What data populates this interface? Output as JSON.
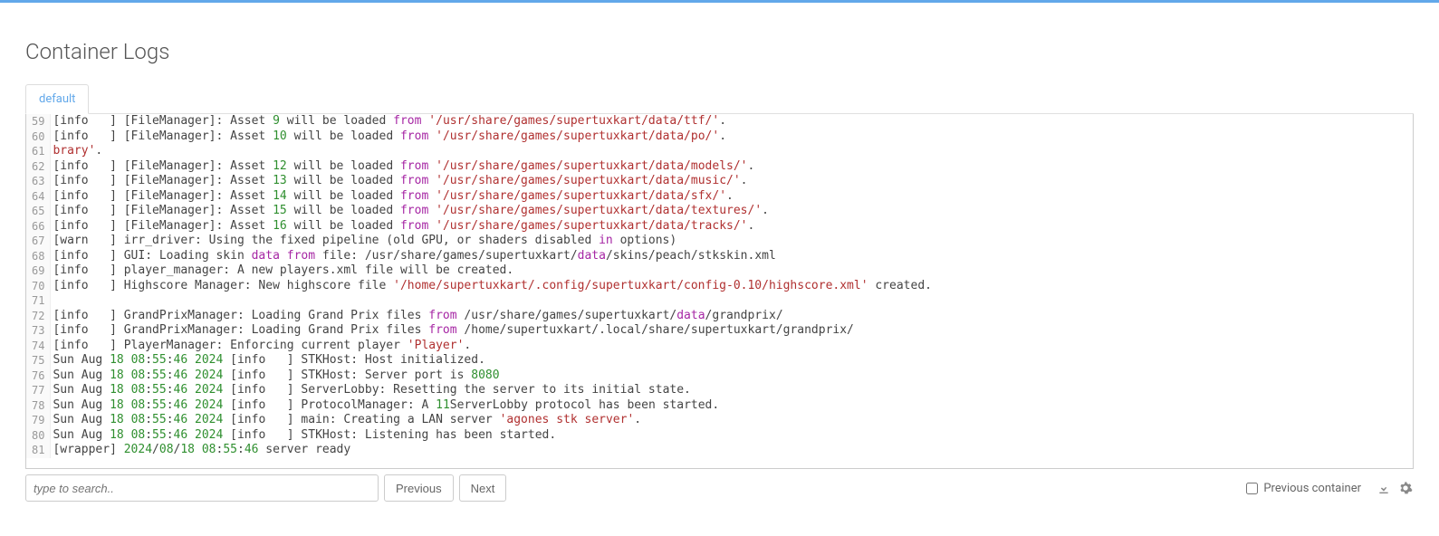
{
  "page": {
    "title": "Container Logs"
  },
  "tabs": {
    "active": "default"
  },
  "search": {
    "placeholder": "type to search.."
  },
  "buttons": {
    "previous": "Previous",
    "next": "Next"
  },
  "footer": {
    "prev_container_label": "Previous container"
  },
  "log_lines": [
    {
      "n": 59,
      "tokens": [
        [
          "[info   ] [FileManager]: Asset ",
          "d"
        ],
        [
          "9",
          "n"
        ],
        [
          " will be loaded ",
          "d"
        ],
        [
          "from",
          "k"
        ],
        [
          " ",
          "d"
        ],
        [
          "'/usr/share/games/supertuxkart/data/ttf/'",
          "s"
        ],
        [
          ".",
          "d"
        ]
      ]
    },
    {
      "n": 60,
      "tokens": [
        [
          "[info   ] [FileManager]: Asset ",
          "d"
        ],
        [
          "10",
          "n"
        ],
        [
          " will be loaded ",
          "d"
        ],
        [
          "from",
          "k"
        ],
        [
          " ",
          "d"
        ],
        [
          "'/usr/share/games/supertuxkart/data/po/'",
          "s"
        ],
        [
          ".",
          "d"
        ]
      ]
    },
    {
      "n": 61,
      "tokens": [
        [
          "brary'",
          "s"
        ],
        [
          ".",
          "d"
        ]
      ]
    },
    {
      "n": 62,
      "tokens": [
        [
          "[info   ] [FileManager]: Asset ",
          "d"
        ],
        [
          "12",
          "n"
        ],
        [
          " will be loaded ",
          "d"
        ],
        [
          "from",
          "k"
        ],
        [
          " ",
          "d"
        ],
        [
          "'/usr/share/games/supertuxkart/data/models/'",
          "s"
        ],
        [
          ".",
          "d"
        ]
      ]
    },
    {
      "n": 63,
      "tokens": [
        [
          "[info   ] [FileManager]: Asset ",
          "d"
        ],
        [
          "13",
          "n"
        ],
        [
          " will be loaded ",
          "d"
        ],
        [
          "from",
          "k"
        ],
        [
          " ",
          "d"
        ],
        [
          "'/usr/share/games/supertuxkart/data/music/'",
          "s"
        ],
        [
          ".",
          "d"
        ]
      ]
    },
    {
      "n": 64,
      "tokens": [
        [
          "[info   ] [FileManager]: Asset ",
          "d"
        ],
        [
          "14",
          "n"
        ],
        [
          " will be loaded ",
          "d"
        ],
        [
          "from",
          "k"
        ],
        [
          " ",
          "d"
        ],
        [
          "'/usr/share/games/supertuxkart/data/sfx/'",
          "s"
        ],
        [
          ".",
          "d"
        ]
      ]
    },
    {
      "n": 65,
      "tokens": [
        [
          "[info   ] [FileManager]: Asset ",
          "d"
        ],
        [
          "15",
          "n"
        ],
        [
          " will be loaded ",
          "d"
        ],
        [
          "from",
          "k"
        ],
        [
          " ",
          "d"
        ],
        [
          "'/usr/share/games/supertuxkart/data/textures/'",
          "s"
        ],
        [
          ".",
          "d"
        ]
      ]
    },
    {
      "n": 66,
      "tokens": [
        [
          "[info   ] [FileManager]: Asset ",
          "d"
        ],
        [
          "16",
          "n"
        ],
        [
          " will be loaded ",
          "d"
        ],
        [
          "from",
          "k"
        ],
        [
          " ",
          "d"
        ],
        [
          "'/usr/share/games/supertuxkart/data/tracks/'",
          "s"
        ],
        [
          ".",
          "d"
        ]
      ]
    },
    {
      "n": 67,
      "tokens": [
        [
          "[warn   ] irr_driver: Using the fixed pipeline (old GPU, or shaders disabled ",
          "d"
        ],
        [
          "in",
          "k"
        ],
        [
          " options)",
          "d"
        ]
      ]
    },
    {
      "n": 68,
      "tokens": [
        [
          "[info   ] GUI: Loading skin ",
          "d"
        ],
        [
          "data",
          "f"
        ],
        [
          " ",
          "d"
        ],
        [
          "from",
          "k"
        ],
        [
          " file: /usr/share/games/supertuxkart/",
          "d"
        ],
        [
          "data",
          "f"
        ],
        [
          "/skins/peach/stkskin.xml",
          "d"
        ]
      ]
    },
    {
      "n": 69,
      "tokens": [
        [
          "[info   ] player_manager: A new players.xml file will be created.",
          "d"
        ]
      ]
    },
    {
      "n": 70,
      "tokens": [
        [
          "[info   ] Highscore Manager: New highscore file ",
          "d"
        ],
        [
          "'/home/supertuxkart/.config/supertuxkart/config-0.10/highscore.xml'",
          "s"
        ],
        [
          " created.",
          "d"
        ]
      ]
    },
    {
      "n": 71,
      "tokens": [
        [
          "",
          "d"
        ]
      ]
    },
    {
      "n": 72,
      "tokens": [
        [
          "[info   ] GrandPrixManager: Loading Grand Prix files ",
          "d"
        ],
        [
          "from",
          "k"
        ],
        [
          " /usr/share/games/supertuxkart/",
          "d"
        ],
        [
          "data",
          "f"
        ],
        [
          "/grandprix/",
          "d"
        ]
      ]
    },
    {
      "n": 73,
      "tokens": [
        [
          "[info   ] GrandPrixManager: Loading Grand Prix files ",
          "d"
        ],
        [
          "from",
          "k"
        ],
        [
          " /home/supertuxkart/.local/share/supertuxkart/grandprix/",
          "d"
        ]
      ]
    },
    {
      "n": 74,
      "tokens": [
        [
          "[info   ] PlayerManager: Enforcing current player ",
          "d"
        ],
        [
          "'Player'",
          "s"
        ],
        [
          ".",
          "d"
        ]
      ]
    },
    {
      "n": 75,
      "tokens": [
        [
          "Sun Aug ",
          "d"
        ],
        [
          "18",
          "n"
        ],
        [
          " ",
          "d"
        ],
        [
          "08",
          "n"
        ],
        [
          ":",
          "d"
        ],
        [
          "55",
          "n"
        ],
        [
          ":",
          "d"
        ],
        [
          "46",
          "n"
        ],
        [
          " ",
          "d"
        ],
        [
          "2024",
          "n"
        ],
        [
          " [info   ] STKHost: Host initialized.",
          "d"
        ]
      ]
    },
    {
      "n": 76,
      "tokens": [
        [
          "Sun Aug ",
          "d"
        ],
        [
          "18",
          "n"
        ],
        [
          " ",
          "d"
        ],
        [
          "08",
          "n"
        ],
        [
          ":",
          "d"
        ],
        [
          "55",
          "n"
        ],
        [
          ":",
          "d"
        ],
        [
          "46",
          "n"
        ],
        [
          " ",
          "d"
        ],
        [
          "2024",
          "n"
        ],
        [
          " [info   ] STKHost: Server port is ",
          "d"
        ],
        [
          "8080",
          "n"
        ]
      ]
    },
    {
      "n": 77,
      "tokens": [
        [
          "Sun Aug ",
          "d"
        ],
        [
          "18",
          "n"
        ],
        [
          " ",
          "d"
        ],
        [
          "08",
          "n"
        ],
        [
          ":",
          "d"
        ],
        [
          "55",
          "n"
        ],
        [
          ":",
          "d"
        ],
        [
          "46",
          "n"
        ],
        [
          " ",
          "d"
        ],
        [
          "2024",
          "n"
        ],
        [
          " [info   ] ServerLobby: Resetting the server to its initial state.",
          "d"
        ]
      ]
    },
    {
      "n": 78,
      "tokens": [
        [
          "Sun Aug ",
          "d"
        ],
        [
          "18",
          "n"
        ],
        [
          " ",
          "d"
        ],
        [
          "08",
          "n"
        ],
        [
          ":",
          "d"
        ],
        [
          "55",
          "n"
        ],
        [
          ":",
          "d"
        ],
        [
          "46",
          "n"
        ],
        [
          " ",
          "d"
        ],
        [
          "2024",
          "n"
        ],
        [
          " [info   ] ProtocolManager: A ",
          "d"
        ],
        [
          "11",
          "n"
        ],
        [
          "ServerLobby protocol has been started.",
          "d"
        ]
      ]
    },
    {
      "n": 79,
      "tokens": [
        [
          "Sun Aug ",
          "d"
        ],
        [
          "18",
          "n"
        ],
        [
          " ",
          "d"
        ],
        [
          "08",
          "n"
        ],
        [
          ":",
          "d"
        ],
        [
          "55",
          "n"
        ],
        [
          ":",
          "d"
        ],
        [
          "46",
          "n"
        ],
        [
          " ",
          "d"
        ],
        [
          "2024",
          "n"
        ],
        [
          " [info   ] main: Creating a LAN server ",
          "d"
        ],
        [
          "'agones stk server'",
          "s"
        ],
        [
          ".",
          "d"
        ]
      ]
    },
    {
      "n": 80,
      "tokens": [
        [
          "Sun Aug ",
          "d"
        ],
        [
          "18",
          "n"
        ],
        [
          " ",
          "d"
        ],
        [
          "08",
          "n"
        ],
        [
          ":",
          "d"
        ],
        [
          "55",
          "n"
        ],
        [
          ":",
          "d"
        ],
        [
          "46",
          "n"
        ],
        [
          " ",
          "d"
        ],
        [
          "2024",
          "n"
        ],
        [
          " [info   ] STKHost: Listening has been started.",
          "d"
        ]
      ]
    },
    {
      "n": 81,
      "tokens": [
        [
          "[wrapper] ",
          "d"
        ],
        [
          "2024",
          "n"
        ],
        [
          "/",
          "d"
        ],
        [
          "08",
          "n"
        ],
        [
          "/",
          "d"
        ],
        [
          "18",
          "n"
        ],
        [
          " ",
          "d"
        ],
        [
          "08",
          "n"
        ],
        [
          ":",
          "d"
        ],
        [
          "55",
          "n"
        ],
        [
          ":",
          "d"
        ],
        [
          "46",
          "n"
        ],
        [
          " server ready",
          "d"
        ]
      ]
    }
  ]
}
